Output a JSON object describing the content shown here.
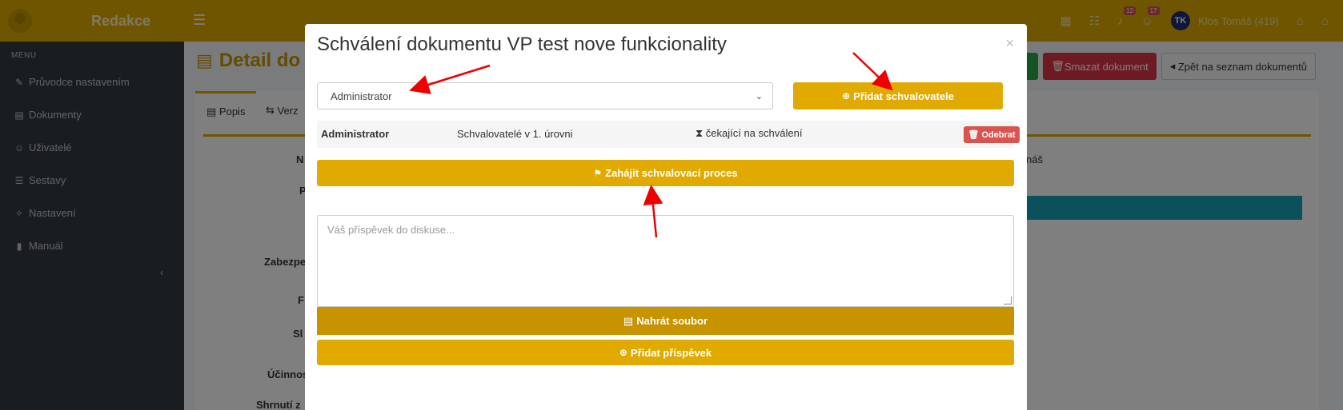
{
  "app": {
    "brand_name": "Redakce",
    "user_initials": "TK",
    "user_name": "Klos Tomáš (419)",
    "badges": [
      "12",
      "17"
    ]
  },
  "sidebar": {
    "caption": "MENU",
    "items": [
      {
        "label": "Průvodce nastavením",
        "icon": "magic-icon"
      },
      {
        "label": "Dokumenty",
        "icon": "file-icon"
      },
      {
        "label": "Uživatelé",
        "icon": "users-icon"
      },
      {
        "label": "Sestavy",
        "icon": "list-icon"
      },
      {
        "label": "Nastavení",
        "icon": "wrench-icon"
      },
      {
        "label": "Manuál",
        "icon": "book-icon"
      }
    ]
  },
  "page": {
    "title": "Detail do",
    "delete_label": "Smazat dokument",
    "back_label": "Zpět na seznam dokumentů",
    "tabs": [
      "Popis",
      "Verz"
    ],
    "side_labels": [
      "N",
      "P",
      "Zabezpe",
      "F",
      "Sl",
      "Účinnos",
      "Shrnutí z"
    ],
    "side_text": "náš"
  },
  "modal": {
    "title": "Schválení dokumentu VP test nove funkcionality",
    "close": "×",
    "select_value": "Administrator",
    "add_approver_label": "Přidat schvalovatele",
    "approver_row": {
      "name": "Administrator",
      "level": "Schvalovatelé v 1. úrovni",
      "status": "čekající na schválení",
      "remove_label": "Odebrat"
    },
    "start_process_label": "Zahájit schvalovací proces",
    "comment_placeholder": "Váš příspěvek do diskuse...",
    "upload_label": "Nahrát soubor",
    "add_comment_label": "Přidat příspěvek"
  },
  "colors": {
    "accent": "#e0aa00",
    "danger": "#d9534f",
    "annotation": "#ee0000"
  }
}
